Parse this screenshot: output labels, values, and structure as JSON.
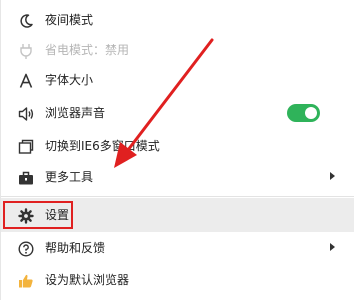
{
  "menu": {
    "items": [
      {
        "icon": "moon-icon",
        "label": "夜间模式"
      },
      {
        "icon": "power-save-icon",
        "label": "省电模式：禁用",
        "disabled": true
      },
      {
        "icon": "font-size-icon",
        "label": "字体大小"
      },
      {
        "icon": "speaker-icon",
        "label": "浏览器声音",
        "toggle_on": true
      },
      {
        "icon": "window-switch-icon",
        "label": "切换到IE6多窗口模式"
      },
      {
        "icon": "toolbox-icon",
        "label": "更多工具",
        "has_submenu": true
      },
      {
        "icon": "gear-icon",
        "label": "设置",
        "highlighted": true
      },
      {
        "icon": "help-icon",
        "label": "帮助和反馈",
        "has_submenu": true
      },
      {
        "icon": "thumbs-up-icon",
        "label": "设为默认浏览器"
      }
    ]
  },
  "colors": {
    "toggle_on": "#2fb35a",
    "annotation_red": "#e02020",
    "highlight_bg": "#ececec"
  }
}
